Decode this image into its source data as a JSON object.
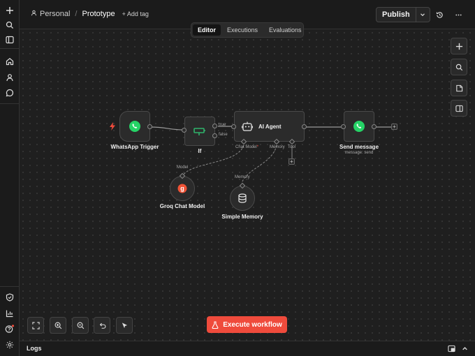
{
  "header": {
    "project": "Personal",
    "separator": "/",
    "workflow_name": "Prototype",
    "add_tag": "+ Add tag",
    "publish_label": "Publish"
  },
  "tabs": [
    {
      "label": "Editor",
      "active": true
    },
    {
      "label": "Executions",
      "active": false
    },
    {
      "label": "Evaluations",
      "active": false
    }
  ],
  "nodes": {
    "whatsapp_trigger": {
      "label": "WhatsApp Trigger"
    },
    "if_node": {
      "label": "If",
      "out_true": "true",
      "out_false": "false"
    },
    "ai_agent": {
      "label": "AI Agent",
      "port_chat_model": "Chat Model",
      "required_mark": "*",
      "port_memory": "Memory",
      "port_tool": "Tool"
    },
    "send_message": {
      "label": "Send message",
      "subtitle": "message: send"
    },
    "groq_chat_model": {
      "label": "Groq Chat Model",
      "conn_label": "Model"
    },
    "simple_memory": {
      "label": "Simple Memory",
      "conn_label": "Memory"
    }
  },
  "bottom": {
    "execute_label": "Execute workflow"
  },
  "logs": {
    "label": "Logs"
  },
  "colors": {
    "accent": "#ef4b3c",
    "whatsapp": "#25d366",
    "if_green": "#2fb36b",
    "canvas": "#1f1f1f"
  },
  "icons": [
    "plus-icon",
    "search-icon",
    "sidebar-icon",
    "home-icon",
    "user-icon",
    "chat-icon",
    "template-icon",
    "insights-icon",
    "help-icon",
    "settings-icon",
    "history-icon",
    "more-icon",
    "zoom-fit-icon",
    "zoom-in-icon",
    "zoom-out-icon",
    "undo-icon",
    "cursor-icon",
    "flask-icon",
    "sticky-note-icon",
    "panel-icon"
  ]
}
